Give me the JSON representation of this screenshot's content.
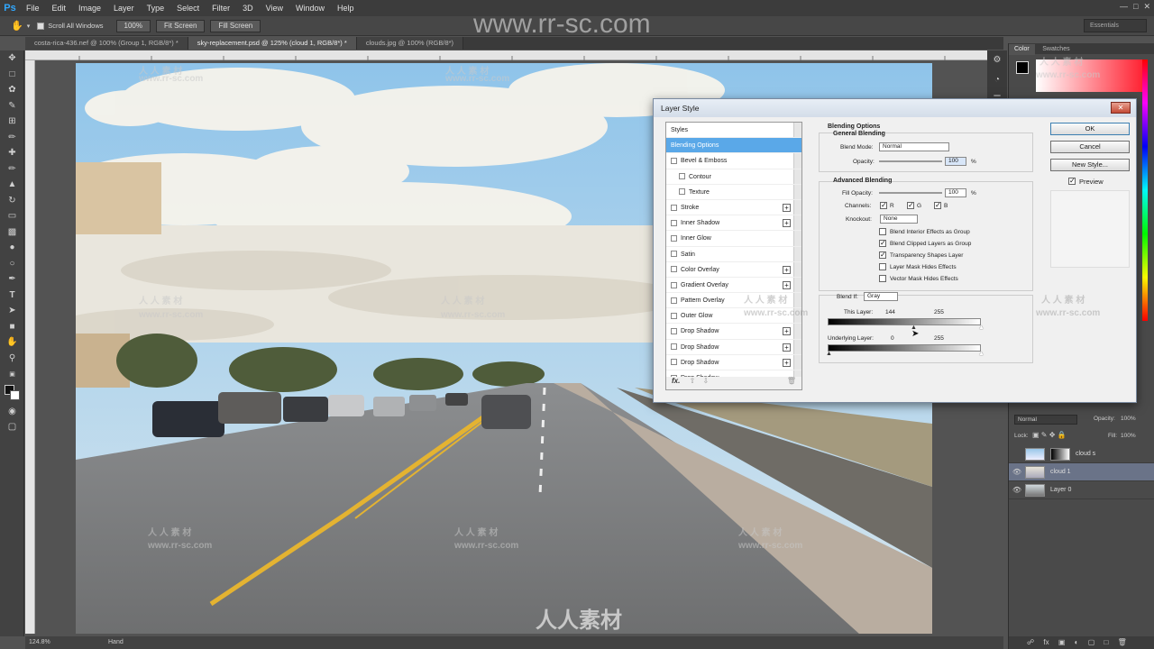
{
  "menubar": {
    "logo": "Ps",
    "items": [
      "File",
      "Edit",
      "Image",
      "Layer",
      "Type",
      "Select",
      "Filter",
      "3D",
      "View",
      "Window",
      "Help"
    ]
  },
  "options_bar": {
    "scroll_all_windows": "Scroll All Windows",
    "zoom_100": "100%",
    "fit_screen": "Fit Screen",
    "fill_screen": "Fill Screen",
    "workspace": "Essentials"
  },
  "doc_tabs": [
    {
      "label": "costa-rica-436.nef @ 100% (Group 1, RGB/8*) *",
      "active": false
    },
    {
      "label": "sky-replacement.psd @ 125% (cloud 1, RGB/8*) *",
      "active": true
    },
    {
      "label": "clouds.jpg @ 100% (RGB/8*)",
      "active": false
    }
  ],
  "status": {
    "zoom": "124.8%",
    "tool": "Hand"
  },
  "right_panel": {
    "tabs": [
      "Color",
      "Swatches"
    ],
    "layers": {
      "blend_mode": "Normal",
      "opacity_label": "Opacity:",
      "opacity_value": "100%",
      "lock_label": "Lock:",
      "fill_label": "Fill:",
      "fill_value": "100%",
      "rows": [
        {
          "name": "cloud s",
          "selected": false
        },
        {
          "name": "cloud 1",
          "selected": true
        },
        {
          "name": "Layer 0",
          "selected": false
        }
      ]
    }
  },
  "dialog": {
    "title": "Layer Style",
    "styles": [
      {
        "label": "Styles",
        "checkbox": false,
        "plus": false,
        "indent": false,
        "selected": false
      },
      {
        "label": "Blending Options",
        "checkbox": false,
        "plus": false,
        "indent": false,
        "selected": true
      },
      {
        "label": "Bevel & Emboss",
        "checkbox": true,
        "plus": false,
        "indent": false,
        "selected": false
      },
      {
        "label": "Contour",
        "checkbox": true,
        "plus": false,
        "indent": true,
        "selected": false
      },
      {
        "label": "Texture",
        "checkbox": true,
        "plus": false,
        "indent": true,
        "selected": false
      },
      {
        "label": "Stroke",
        "checkbox": true,
        "plus": true,
        "indent": false,
        "selected": false
      },
      {
        "label": "Inner Shadow",
        "checkbox": true,
        "plus": true,
        "indent": false,
        "selected": false
      },
      {
        "label": "Inner Glow",
        "checkbox": true,
        "plus": false,
        "indent": false,
        "selected": false
      },
      {
        "label": "Satin",
        "checkbox": true,
        "plus": false,
        "indent": false,
        "selected": false
      },
      {
        "label": "Color Overlay",
        "checkbox": true,
        "plus": true,
        "indent": false,
        "selected": false
      },
      {
        "label": "Gradient Overlay",
        "checkbox": true,
        "plus": true,
        "indent": false,
        "selected": false
      },
      {
        "label": "Pattern Overlay",
        "checkbox": true,
        "plus": false,
        "indent": false,
        "selected": false
      },
      {
        "label": "Outer Glow",
        "checkbox": true,
        "plus": false,
        "indent": false,
        "selected": false
      },
      {
        "label": "Drop Shadow",
        "checkbox": true,
        "plus": true,
        "indent": false,
        "selected": false
      },
      {
        "label": "Drop Shadow",
        "checkbox": true,
        "plus": true,
        "indent": false,
        "selected": false
      },
      {
        "label": "Drop Shadow",
        "checkbox": true,
        "plus": true,
        "indent": false,
        "selected": false
      },
      {
        "label": "Drop Shadow",
        "checkbox": true,
        "plus": false,
        "indent": false,
        "selected": false
      }
    ],
    "fx_label": "fx.",
    "blending_options_title": "Blending Options",
    "general_blending_title": "General Blending",
    "blend_mode_label": "Blend Mode:",
    "blend_mode_value": "Normal",
    "opacity_label": "Opacity:",
    "opacity_value": "100",
    "percent": "%",
    "advanced_blending_title": "Advanced Blending",
    "fill_opacity_label": "Fill Opacity:",
    "fill_opacity_value": "100",
    "channels_label": "Channels:",
    "channel_r": "R",
    "channel_g": "G",
    "channel_b": "B",
    "knockout_label": "Knockout:",
    "knockout_value": "None",
    "checks": [
      {
        "label": "Blend Interior Effects as Group",
        "checked": false
      },
      {
        "label": "Blend Clipped Layers as Group",
        "checked": true
      },
      {
        "label": "Transparency Shapes Layer",
        "checked": true
      },
      {
        "label": "Layer Mask Hides Effects",
        "checked": false
      },
      {
        "label": "Vector Mask Hides Effects",
        "checked": false
      }
    ],
    "blend_if_label": "Blend If:",
    "blend_if_value": "Gray",
    "this_layer_label": "This Layer:",
    "this_layer_low": "144",
    "this_layer_high": "255",
    "underlying_label": "Underlying Layer:",
    "underlying_low": "0",
    "underlying_high": "255",
    "ok": "OK",
    "cancel": "Cancel",
    "new_style": "New Style...",
    "preview": "Preview"
  },
  "watermark": {
    "url": "www.rr-sc.com",
    "chinese": "人人素材",
    "cn_small": "人 人 素 材",
    "url_small": "www.rr-sc.com"
  }
}
